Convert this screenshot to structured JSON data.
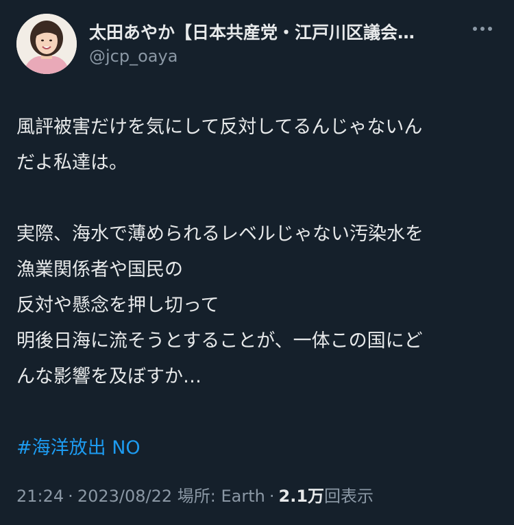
{
  "author": {
    "display_name": "太田あやか【日本共産党・江戸川区議会…",
    "handle": "@jcp_oaya"
  },
  "more_icon": "more-horizontal-icon",
  "body": {
    "lines": [
      "風評被害だけを気にして反対してるんじゃないん",
      "だよ私達は。",
      "",
      "実際、海水で薄められるレベルじゃない汚染水を",
      "漁業関係者や国民の",
      "反対や懸念を押し切って",
      "明後日海に流そうとすることが、一体この国にど",
      "んな影響を及ぼすか…"
    ],
    "hashtag": "#海洋放出 NO"
  },
  "meta": {
    "time": "21:24",
    "date": "2023/08/22",
    "location": "場所: Earth",
    "view_count": "2.1万",
    "view_label": "回表示"
  },
  "colors": {
    "background": "#15202b",
    "text": "#e7e9ea",
    "secondary": "#8b98a5",
    "link": "#1d9bf0"
  }
}
